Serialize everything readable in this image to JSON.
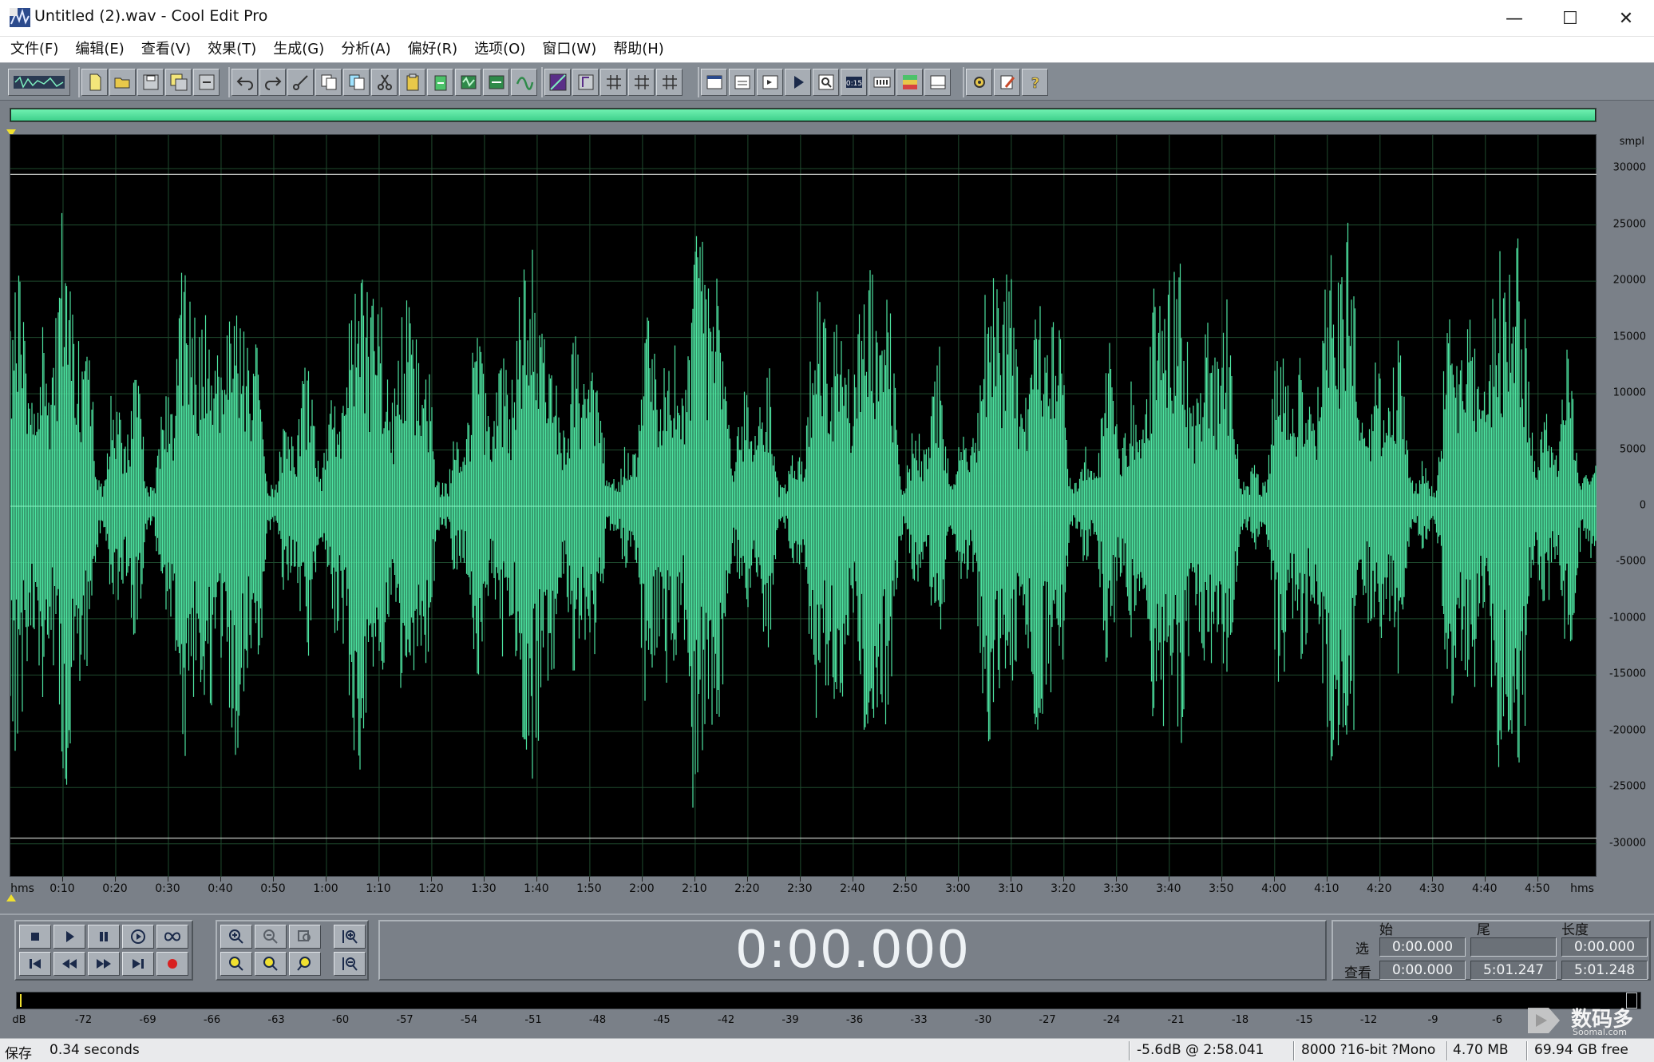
{
  "window": {
    "title": "Untitled (2).wav - Cool Edit Pro",
    "minimize_glyph": "—",
    "maximize_glyph": "☐",
    "close_glyph": "✕"
  },
  "menu": [
    {
      "label": "文件(F)"
    },
    {
      "label": "编辑(E)"
    },
    {
      "label": "查看(V)"
    },
    {
      "label": "效果(T)"
    },
    {
      "label": "生成(G)"
    },
    {
      "label": "分析(A)"
    },
    {
      "label": "偏好(R)"
    },
    {
      "label": "选项(O)"
    },
    {
      "label": "窗口(W)"
    },
    {
      "label": "帮助(H)"
    }
  ],
  "waveform": {
    "y_unit": "smpl",
    "y_ticks": [
      30000,
      25000,
      20000,
      15000,
      10000,
      5000,
      0,
      -5000,
      -10000,
      -15000,
      -20000,
      -25000,
      -30000
    ],
    "y_range": [
      -33000,
      33000
    ],
    "clip_lines": [
      29500,
      -29500
    ],
    "time_unit": "hms",
    "time_ticks": [
      "0:10",
      "0:20",
      "0:30",
      "0:40",
      "0:50",
      "1:00",
      "1:10",
      "1:20",
      "1:30",
      "1:40",
      "1:50",
      "2:00",
      "2:10",
      "2:20",
      "2:30",
      "2:40",
      "2:50",
      "3:00",
      "3:10",
      "3:20",
      "3:30",
      "3:40",
      "3:50",
      "4:00",
      "4:10",
      "4:20",
      "4:30",
      "4:40",
      "4:50"
    ],
    "duration_seconds": 301.248,
    "wave_color": "#4de3a0",
    "grid_color": "#1f4a2e"
  },
  "transport": {
    "time_display": "0:00.000"
  },
  "selection": {
    "col_start": "始",
    "col_end": "尾",
    "col_length": "长度",
    "row_select": "选",
    "row_view": "查看",
    "sel_start": "0:00.000",
    "sel_end": "",
    "sel_length": "0:00.000",
    "view_start": "0:00.000",
    "view_end": "5:01.247",
    "view_length": "5:01.248"
  },
  "meter": {
    "labels": [
      "dB",
      "-72",
      "-69",
      "-66",
      "-63",
      "-60",
      "-57",
      "-54",
      "-51",
      "-48",
      "-45",
      "-42",
      "-39",
      "-36",
      "-33",
      "-30",
      "-27",
      "-24",
      "-21",
      "-18",
      "-15",
      "-12",
      "-9",
      "-6"
    ]
  },
  "status": {
    "action": "保存",
    "action_time": "0.34 seconds",
    "level_at": "-5.6dB @ 2:58.041",
    "format": "8000 ?16-bit ?Mono",
    "file_size": "4.70 MB",
    "free_space": "69.94 GB free"
  },
  "watermark": {
    "main": "数码多",
    "sub": "Soomal.com"
  }
}
